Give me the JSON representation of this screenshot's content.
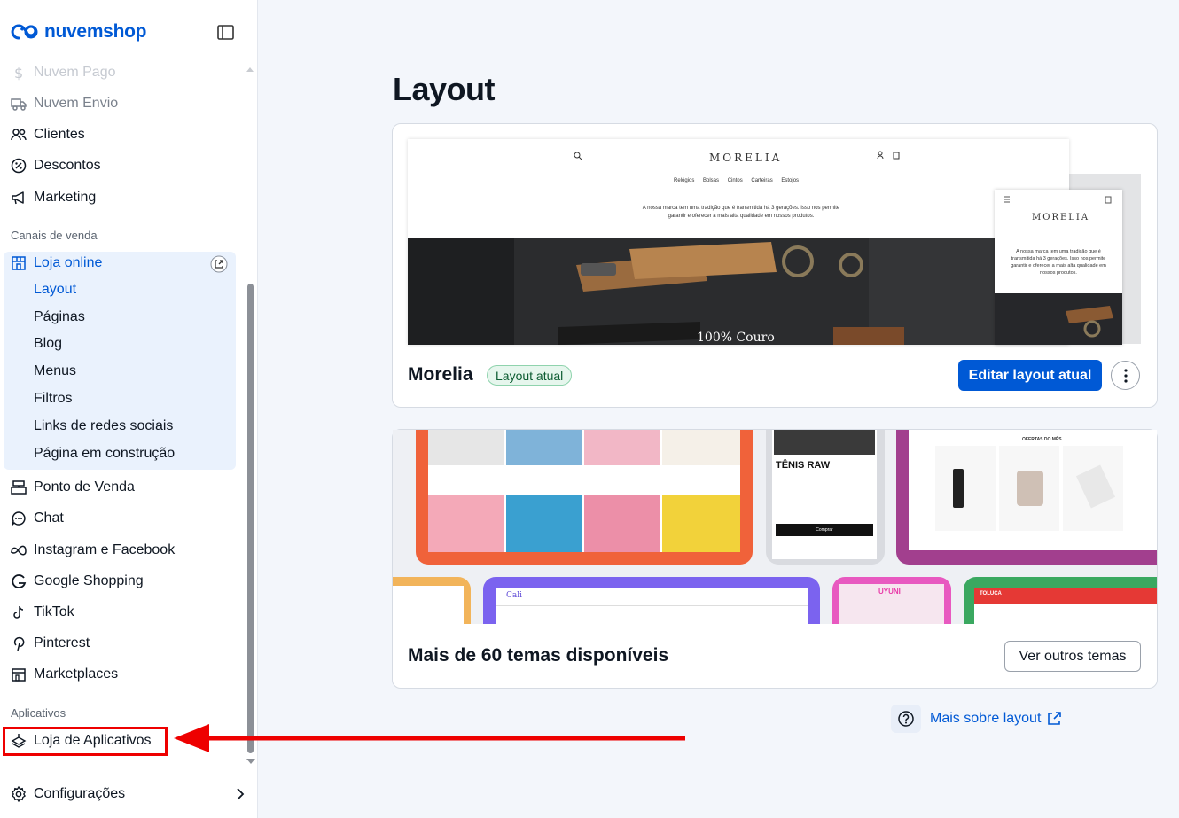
{
  "brand": {
    "name": "nuvemshop",
    "color": "#0059d5"
  },
  "sidebar": {
    "items_top": [
      {
        "label": "Nuvem Pago",
        "icon": "dollar-icon"
      },
      {
        "label": "Nuvem Envio",
        "icon": "truck-icon"
      },
      {
        "label": "Clientes",
        "icon": "users-icon"
      },
      {
        "label": "Descontos",
        "icon": "discount-icon"
      },
      {
        "label": "Marketing",
        "icon": "megaphone-icon"
      }
    ],
    "section_sales": "Canais de venda",
    "online_store": {
      "label": "Loja online",
      "icon": "store-icon",
      "external_icon": "external-link-icon",
      "sub_items": [
        "Layout",
        "Páginas",
        "Blog",
        "Menus",
        "Filtros",
        "Links de redes sociais",
        "Página em construção"
      ],
      "active_sub": "Layout"
    },
    "items_channels": [
      {
        "label": "Ponto de Venda",
        "icon": "pos-icon"
      },
      {
        "label": "Chat",
        "icon": "chat-icon"
      },
      {
        "label": "Instagram e Facebook",
        "icon": "meta-icon"
      },
      {
        "label": "Google Shopping",
        "icon": "google-icon"
      },
      {
        "label": "TikTok",
        "icon": "tiktok-icon"
      },
      {
        "label": "Pinterest",
        "icon": "pinterest-icon"
      },
      {
        "label": "Marketplaces",
        "icon": "marketplace-icon"
      }
    ],
    "section_apps": "Aplicativos",
    "app_store": {
      "label": "Loja de Aplicativos",
      "icon": "apps-icon"
    },
    "settings": {
      "label": "Configurações",
      "icon": "gear-icon"
    }
  },
  "main": {
    "title": "Layout",
    "current_theme": {
      "name": "Morelia",
      "badge": "Layout atual",
      "edit_button": "Editar layout atual",
      "preview": {
        "brand": "MORELIA",
        "menu": "Relógios Bolsas Cintos Carteiras Estojos",
        "text": "A nossa marca tem uma tradição que é transmitida há 3 gerações. Isso nos permite garantir e oferecer a mais alta qualidade em nossos produtos.",
        "caption": "100% Couro"
      }
    },
    "themes_card": {
      "title": "Mais de 60 temas disponíveis",
      "button": "Ver outros temas",
      "art_labels": {
        "tenis": "TÊNIS RAW",
        "ofertas": "OFERTAS DO MÊS",
        "uyuni": "UYUNI",
        "cali": "Cali",
        "toluca": "TOLUCA",
        "comprar": "Comprar"
      }
    },
    "help": {
      "label": "Mais sobre layout"
    }
  },
  "colors": {
    "primary": "#0059d5",
    "annotation": "#ee0000"
  }
}
